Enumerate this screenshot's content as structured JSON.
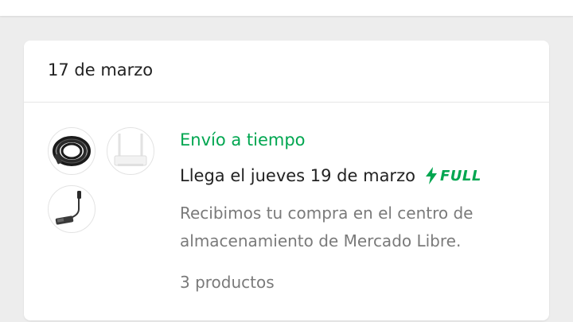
{
  "order": {
    "date_title": "17 de marzo",
    "products": [
      {
        "icon": "cable-coil-product-icon"
      },
      {
        "icon": "wifi-router-product-icon"
      },
      {
        "icon": "microphone-product-icon"
      }
    ],
    "status": "Envío a tiempo",
    "status_color": "#00a650",
    "arrival": "Llega el jueves 19 de marzo",
    "badge": "FULL",
    "badge_icon": "lightning-bolt-icon",
    "description": "Recibimos tu compra en el centro de almacenamiento de Mercado Libre.",
    "product_count": "3 productos"
  }
}
